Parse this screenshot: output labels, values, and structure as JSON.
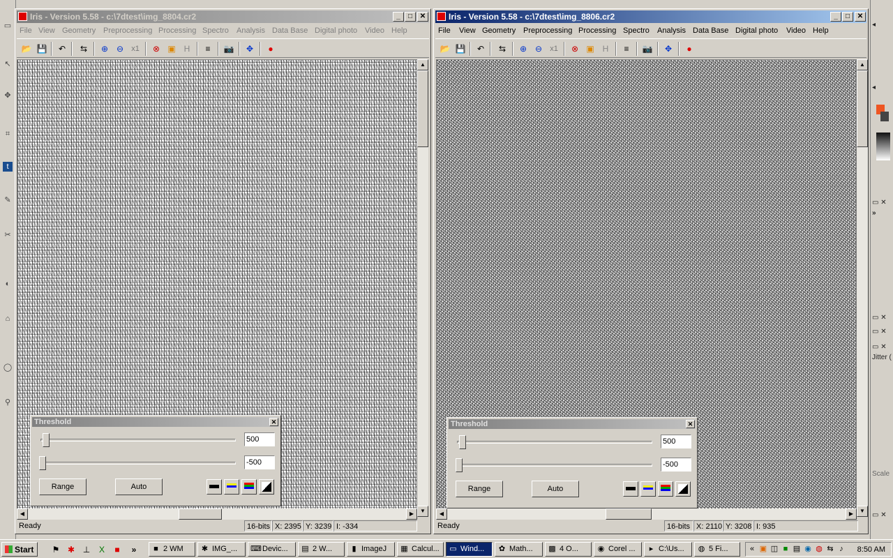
{
  "windows": [
    {
      "title": "Iris - Version 5.58 - c:\\7dtest\\img_8804.cr2",
      "active": false,
      "menu": [
        "File",
        "View",
        "Geometry",
        "Preprocessing",
        "Processing",
        "Spectro",
        "Analysis",
        "Data Base",
        "Digital photo",
        "Video",
        "Help"
      ],
      "status": {
        "ready": "Ready",
        "bits": "16-bits",
        "x": "X: 2395",
        "y": "Y: 3239",
        "i": "I: -334"
      },
      "threshold": {
        "title": "Threshold",
        "high": "500",
        "low": "-500",
        "range_label": "Range",
        "auto_label": "Auto"
      }
    },
    {
      "title": "Iris - Version 5.58 - c:\\7dtest\\img_8806.cr2",
      "active": true,
      "menu": [
        "File",
        "View",
        "Geometry",
        "Preprocessing",
        "Processing",
        "Spectro",
        "Analysis",
        "Data Base",
        "Digital photo",
        "Video",
        "Help"
      ],
      "status": {
        "ready": "Ready",
        "bits": "16-bits",
        "x": "X: 2110",
        "y": "Y: 3208",
        "i": "I: 935"
      },
      "threshold": {
        "title": "Threshold",
        "high": "500",
        "low": "-500",
        "range_label": "Range",
        "auto_label": "Auto"
      }
    }
  ],
  "toolbar_icons": [
    "open-icon",
    "save-icon",
    "undo-icon",
    "settings-icon",
    "zoom-in-icon",
    "zoom-out-icon",
    "zoom-1x-icon",
    "spectro-icon",
    "box-icon",
    "histogram-icon",
    "list-icon",
    "camera-icon",
    "move-icon",
    "record-icon"
  ],
  "toolbar_glyphs": [
    "📂",
    "💾",
    "↶",
    "⇆",
    "⊕",
    "⊖",
    "x1",
    "⊗",
    "▣",
    "H",
    "≡",
    "📷",
    "✥",
    "●"
  ],
  "right_panel": {
    "jitter_label": "Jitter (",
    "scale_label": "Scale",
    "more_label": "»"
  },
  "taskbar": {
    "start_label": "Start",
    "tasks": [
      {
        "label": "2 WM",
        "icon": "■",
        "active": false
      },
      {
        "label": "IMG_...",
        "icon": "✱",
        "active": false
      },
      {
        "label": "Devic...",
        "icon": "⌨",
        "active": false
      },
      {
        "label": "2 W...",
        "icon": "▤",
        "active": false
      },
      {
        "label": "ImageJ",
        "icon": "▮",
        "active": false
      },
      {
        "label": "Calcul...",
        "icon": "▦",
        "active": false
      },
      {
        "label": "Wind...",
        "icon": "▭",
        "active": true
      },
      {
        "label": "Math...",
        "icon": "✿",
        "active": false
      },
      {
        "label": "4 O...",
        "icon": "▩",
        "active": false
      },
      {
        "label": "Corel ...",
        "icon": "◉",
        "active": false
      },
      {
        "label": "C:\\Us...",
        "icon": "▸",
        "active": false
      },
      {
        "label": "5 Fi...",
        "icon": "◍",
        "active": false
      }
    ],
    "clock": "8:50 AM",
    "chevron": "«"
  },
  "colors": {
    "active_title": "#0a246a",
    "inactive_title": "#808080",
    "record": "#e00000"
  }
}
